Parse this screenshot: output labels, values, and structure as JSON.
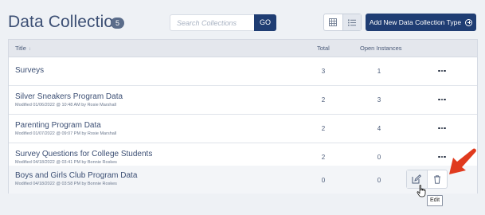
{
  "header": {
    "title": "Data Collection",
    "count": "5",
    "search_placeholder": "Search Collections",
    "go_label": "GO",
    "add_button_label": "Add New Data Collection Type",
    "view_toggle": {
      "grid_icon": "grid-icon",
      "list_icon": "list-icon",
      "selected": "list"
    }
  },
  "table": {
    "columns": {
      "title": "Title",
      "total": "Total",
      "open": "Open Instances"
    },
    "rows": [
      {
        "title": "Surveys",
        "subtitle": "",
        "total": "3",
        "open": "1"
      },
      {
        "title": "Silver Sneakers Program Data",
        "subtitle": "Modified 01/06/2022 @ 10:48 AM by Rosie Marshall",
        "total": "2",
        "open": "3"
      },
      {
        "title": "Parenting Program Data",
        "subtitle": "Modified 01/07/2022 @ 09:07 PM by Rosie Marshall",
        "total": "2",
        "open": "4"
      },
      {
        "title": "Survey Questions for College Students",
        "subtitle": "Modified 04/18/2022 @ 03:41 PM by Bonnie Roskes",
        "total": "2",
        "open": "0"
      },
      {
        "title": "Boys and Girls Club Program Data",
        "subtitle": "Modified 04/18/2022 @ 03:58 PM by Bonnie Roskes",
        "total": "0",
        "open": "0"
      }
    ]
  },
  "tooltip": {
    "text": "Edit"
  },
  "colors": {
    "primary": "#1f3d73",
    "annotation_arrow": "#e03a1e",
    "page_bg": "#eef1f5"
  },
  "icons": {
    "row_menu": "more-dots-icon",
    "edit": "edit-icon",
    "delete": "trash-icon",
    "cursor": "hand-pointer-icon",
    "annotation": "red-arrow-icon"
  }
}
